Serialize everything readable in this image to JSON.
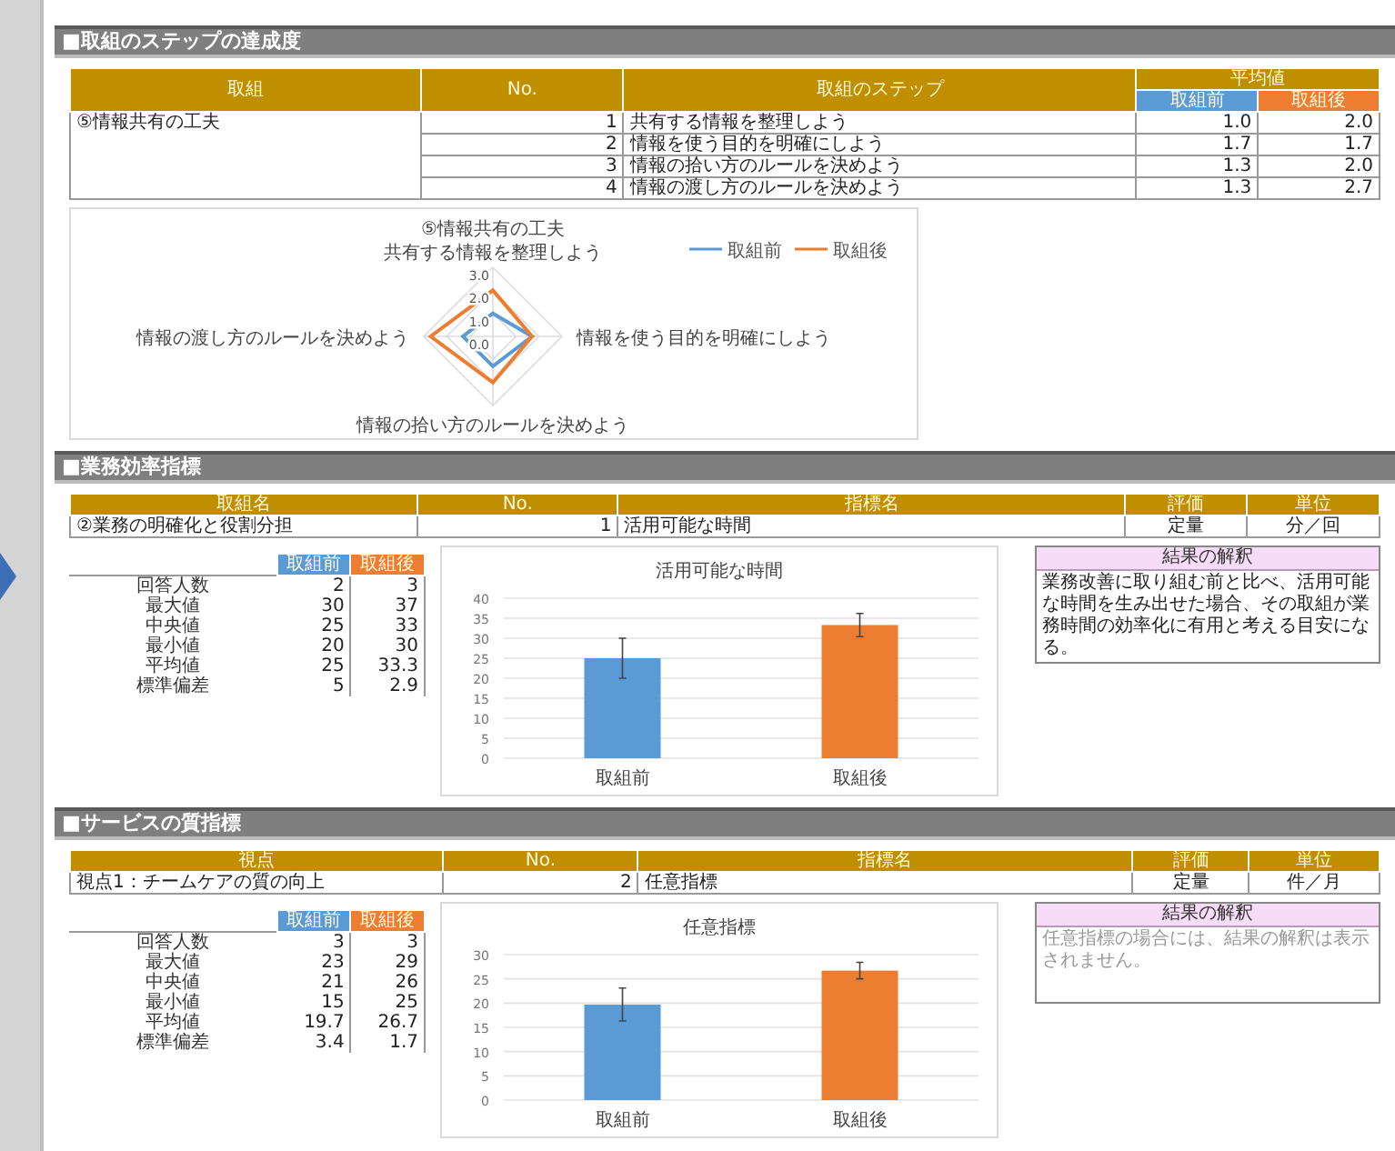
{
  "sections": [
    {
      "kind": "steps",
      "title": "■取組のステップの達成度",
      "table": {
        "columns": [
          "取組",
          "No.",
          "取組のステップ"
        ],
        "group_header": "平均値",
        "sub_columns": [
          {
            "label": "取組前",
            "color": "#5b9bd5"
          },
          {
            "label": "取組後",
            "color": "#ed7d31"
          }
        ],
        "initiative": "⑤情報共有の工夫",
        "rows": [
          {
            "no": "1",
            "step": "共有する情報を整理しよう",
            "before": "1.0",
            "after": "2.0"
          },
          {
            "no": "2",
            "step": "情報を使う目的を明確にしよう",
            "before": "1.7",
            "after": "1.7"
          },
          {
            "no": "3",
            "step": "情報の拾い方のルールを決めよう",
            "before": "1.3",
            "after": "2.0"
          },
          {
            "no": "4",
            "step": "情報の渡し方のルールを決めよう",
            "before": "1.3",
            "after": "2.7"
          }
        ]
      },
      "radar": {
        "title": "⑤情報共有の工夫",
        "legend": [
          {
            "label": "取組前",
            "color": "#5b9bd5"
          },
          {
            "label": "取組後",
            "color": "#ed7d31"
          }
        ],
        "axis_labels": [
          "共有する情報を整理しよう",
          "情報を使う目的を明確にしよう",
          "情報の拾い方のルールを決めよう",
          "情報の渡し方のルールを決めよう"
        ],
        "ticks": [
          "3.0",
          "2.0",
          "1.0",
          "0.0"
        ]
      }
    },
    {
      "kind": "indicator",
      "title": "■業務効率指標",
      "table": {
        "columns": [
          "取組名",
          "No.",
          "指標名",
          "評価",
          "単位"
        ],
        "row": [
          "②業務の明確化と役割分担",
          "1",
          "活用可能な時間",
          "定量",
          "分／回"
        ]
      },
      "stats": {
        "columns": [
          {
            "label": "取組前",
            "color": "#5b9bd5"
          },
          {
            "label": "取組後",
            "color": "#ed7d31"
          }
        ],
        "rows": [
          {
            "label": "回答人数",
            "before": "2",
            "after": "3"
          },
          {
            "label": "最大値",
            "before": "30",
            "after": "37"
          },
          {
            "label": "中央値",
            "before": "25",
            "after": "33"
          },
          {
            "label": "最小値",
            "before": "20",
            "after": "30"
          },
          {
            "label": "平均値",
            "before": "25",
            "after": "33.3"
          },
          {
            "label": "標準偏差",
            "before": "5",
            "after": "2.9"
          }
        ]
      },
      "chart_data": {
        "type": "bar",
        "title": "活用可能な時間",
        "categories": [
          "取組前",
          "取組後"
        ],
        "values": [
          25,
          33.3
        ],
        "grid": true,
        "ylim": [
          0,
          40
        ],
        "yticks": [
          0,
          5,
          10,
          15,
          20,
          25,
          30,
          35,
          40
        ]
      },
      "interpretation": {
        "title": "結果の解釈",
        "text": "業務改善に取り組む前と比べ、活用可能な時間を生み出せた場合、その取組が業務時間の効率化に有用と考える目安になる。",
        "muted": false
      }
    },
    {
      "kind": "indicator",
      "title": "■サービスの質指標",
      "table": {
        "columns": [
          "視点",
          "No.",
          "指標名",
          "評価",
          "単位"
        ],
        "row": [
          "視点1：チームケアの質の向上",
          "2",
          "任意指標",
          "定量",
          "件／月"
        ]
      },
      "stats": {
        "columns": [
          {
            "label": "取組前",
            "color": "#5b9bd5"
          },
          {
            "label": "取組後",
            "color": "#ed7d31"
          }
        ],
        "rows": [
          {
            "label": "回答人数",
            "before": "3",
            "after": "3"
          },
          {
            "label": "最大値",
            "before": "23",
            "after": "29"
          },
          {
            "label": "中央値",
            "before": "21",
            "after": "26"
          },
          {
            "label": "最小値",
            "before": "15",
            "after": "25"
          },
          {
            "label": "平均値",
            "before": "19.7",
            "after": "26.7"
          },
          {
            "label": "標準偏差",
            "before": "3.4",
            "after": "1.7"
          }
        ]
      },
      "chart_data": {
        "type": "bar",
        "title": "任意指標",
        "categories": [
          "取組前",
          "取組後"
        ],
        "values": [
          19.7,
          26.7
        ],
        "grid": true,
        "ylim": [
          0,
          30
        ],
        "yticks": [
          0,
          5,
          10,
          15,
          20,
          25,
          30
        ]
      },
      "interpretation": {
        "title": "結果の解釈",
        "text": "任意指標の場合には、結果の解釈は表示されません。",
        "muted": true
      }
    }
  ]
}
